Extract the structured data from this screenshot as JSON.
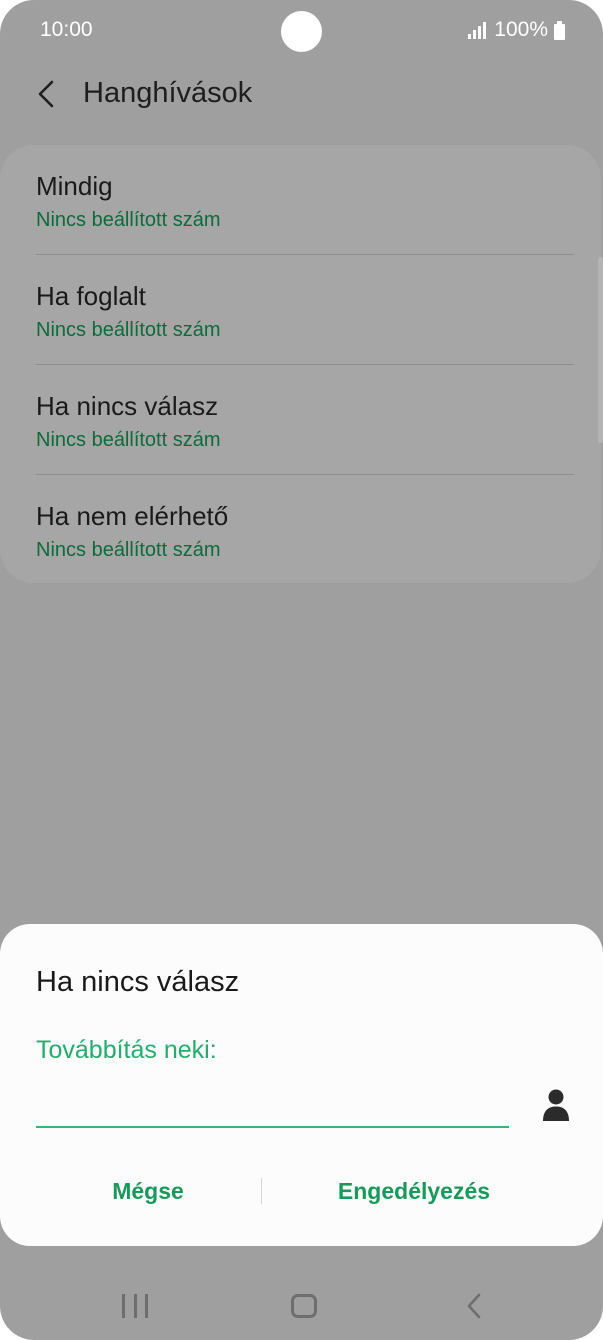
{
  "status_bar": {
    "time": "10:00",
    "battery": "100%"
  },
  "app_bar": {
    "title": "Hanghívások"
  },
  "options": [
    {
      "title": "Mindig",
      "subtitle": "Nincs beállított szám"
    },
    {
      "title": "Ha foglalt",
      "subtitle": "Nincs beállított szám"
    },
    {
      "title": "Ha nincs válasz",
      "subtitle": "Nincs beállított szám"
    },
    {
      "title": "Ha nem elérhető",
      "subtitle": "Nincs beállított szám"
    }
  ],
  "dialog": {
    "title": "Ha nincs válasz",
    "field_label": "Továbbítás neki:",
    "input_value": "",
    "input_placeholder": "",
    "cancel_label": "Mégse",
    "enable_label": "Engedélyezés"
  },
  "colors": {
    "accent": "#24ad6c",
    "button_text": "#1a9a5a",
    "subtitle_text": "#0d6b3c",
    "scrim": "#9f9f9f"
  },
  "icons": {
    "back": "chevron-left-icon",
    "contact": "person-icon",
    "nav_recent": "recent-apps-icon",
    "nav_home": "home-icon",
    "nav_back": "back-icon"
  }
}
